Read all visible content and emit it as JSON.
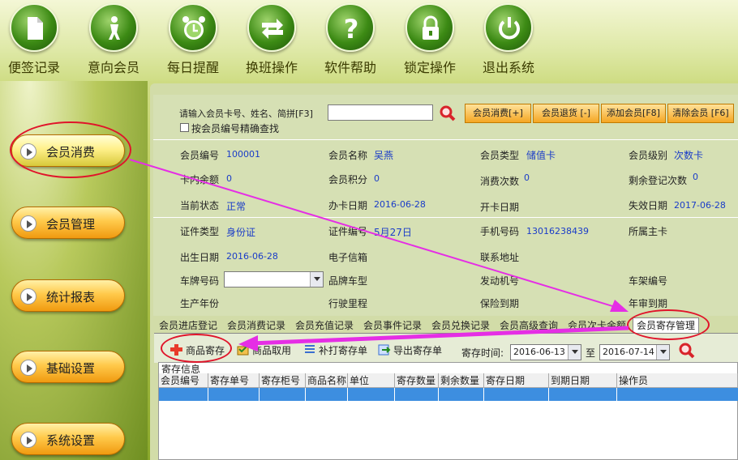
{
  "toolbar": [
    {
      "label": "便签记录",
      "icon": "document-icon"
    },
    {
      "label": "意向会员",
      "icon": "person-walk-icon"
    },
    {
      "label": "每日提醒",
      "icon": "alarm-clock-icon"
    },
    {
      "label": "换班操作",
      "icon": "swap-arrows-icon"
    },
    {
      "label": "软件帮助",
      "icon": "question-icon"
    },
    {
      "label": "锁定操作",
      "icon": "lock-icon"
    },
    {
      "label": "退出系统",
      "icon": "power-icon"
    }
  ],
  "sidebar": [
    "会员消费",
    "会员管理",
    "统计报表",
    "基础设置",
    "系统设置"
  ],
  "search": {
    "label": "请输入会员卡号、姓名、简拼[F3]",
    "value": "",
    "exact_label": "按会员编号精确查找"
  },
  "buttons": {
    "consume": "会员消费[+]",
    "refund": "会员退货 [-]",
    "add": "添加会员[F8]",
    "clear": "清除会员 [F6]"
  },
  "fields": {
    "member_no_label": "会员编号",
    "member_no": "100001",
    "name_label": "会员名称",
    "name": "吴燕",
    "type_label": "会员类型",
    "type": "储值卡",
    "level_label": "会员级别",
    "level": "次数卡",
    "balance_label": "卡内余额",
    "balance": "0",
    "points_label": "会员积分",
    "points": "0",
    "count_label": "消费次数",
    "count": "0",
    "remain_label": "剩余登记次数",
    "remain": "0",
    "status_label": "当前状态",
    "status": "正常",
    "issue_label": "办卡日期",
    "issue": "2016-06-28",
    "open_label": "开卡日期",
    "open": "",
    "expire_label": "失效日期",
    "expire": "2017-06-28",
    "idtype_label": "证件类型",
    "idtype": "身份证",
    "idno_label": "证件编号",
    "idno": "5月27日",
    "phone_label": "手机号码",
    "phone": "13016238439",
    "owner_label": "所属主卡",
    "owner": "",
    "birth_label": "出生日期",
    "birth": "2016-06-28",
    "email_label": "电子信箱",
    "address_label": "联系地址",
    "plate_label": "车牌号码",
    "plate": "",
    "model_label": "品牌车型",
    "engine_label": "发动机号",
    "frame_label": "车架编号",
    "year_label": "生产年份",
    "mileage_label": "行驶里程",
    "insurance_label": "保险到期",
    "inspection_label": "年审到期"
  },
  "tabs": [
    "会员进店登记",
    "会员消费记录",
    "会员充值记录",
    "会员事件记录",
    "会员兑换记录",
    "会员高级查询",
    "会员次卡余额",
    "会员寄存管理"
  ],
  "subtoolbar": {
    "deposit": "商品寄存",
    "withdraw": "商品取用",
    "reprint": "补打寄存单",
    "export": "导出寄存单",
    "time_label": "寄存时间:",
    "from": "2016-06-13",
    "to_label": "至",
    "to": "2016-07-14"
  },
  "grid": {
    "caption": "寄存信息",
    "columns": [
      "会员编号",
      "寄存单号",
      "寄存柜号",
      "商品名称",
      "单位",
      "寄存数量",
      "剩余数量",
      "寄存日期",
      "到期日期",
      "操作员"
    ]
  },
  "colors": {
    "accent": "#3d8ee0",
    "value_text": "#1a3cc8",
    "annotation": "#e0142a",
    "arrow": "#e52ee5"
  }
}
